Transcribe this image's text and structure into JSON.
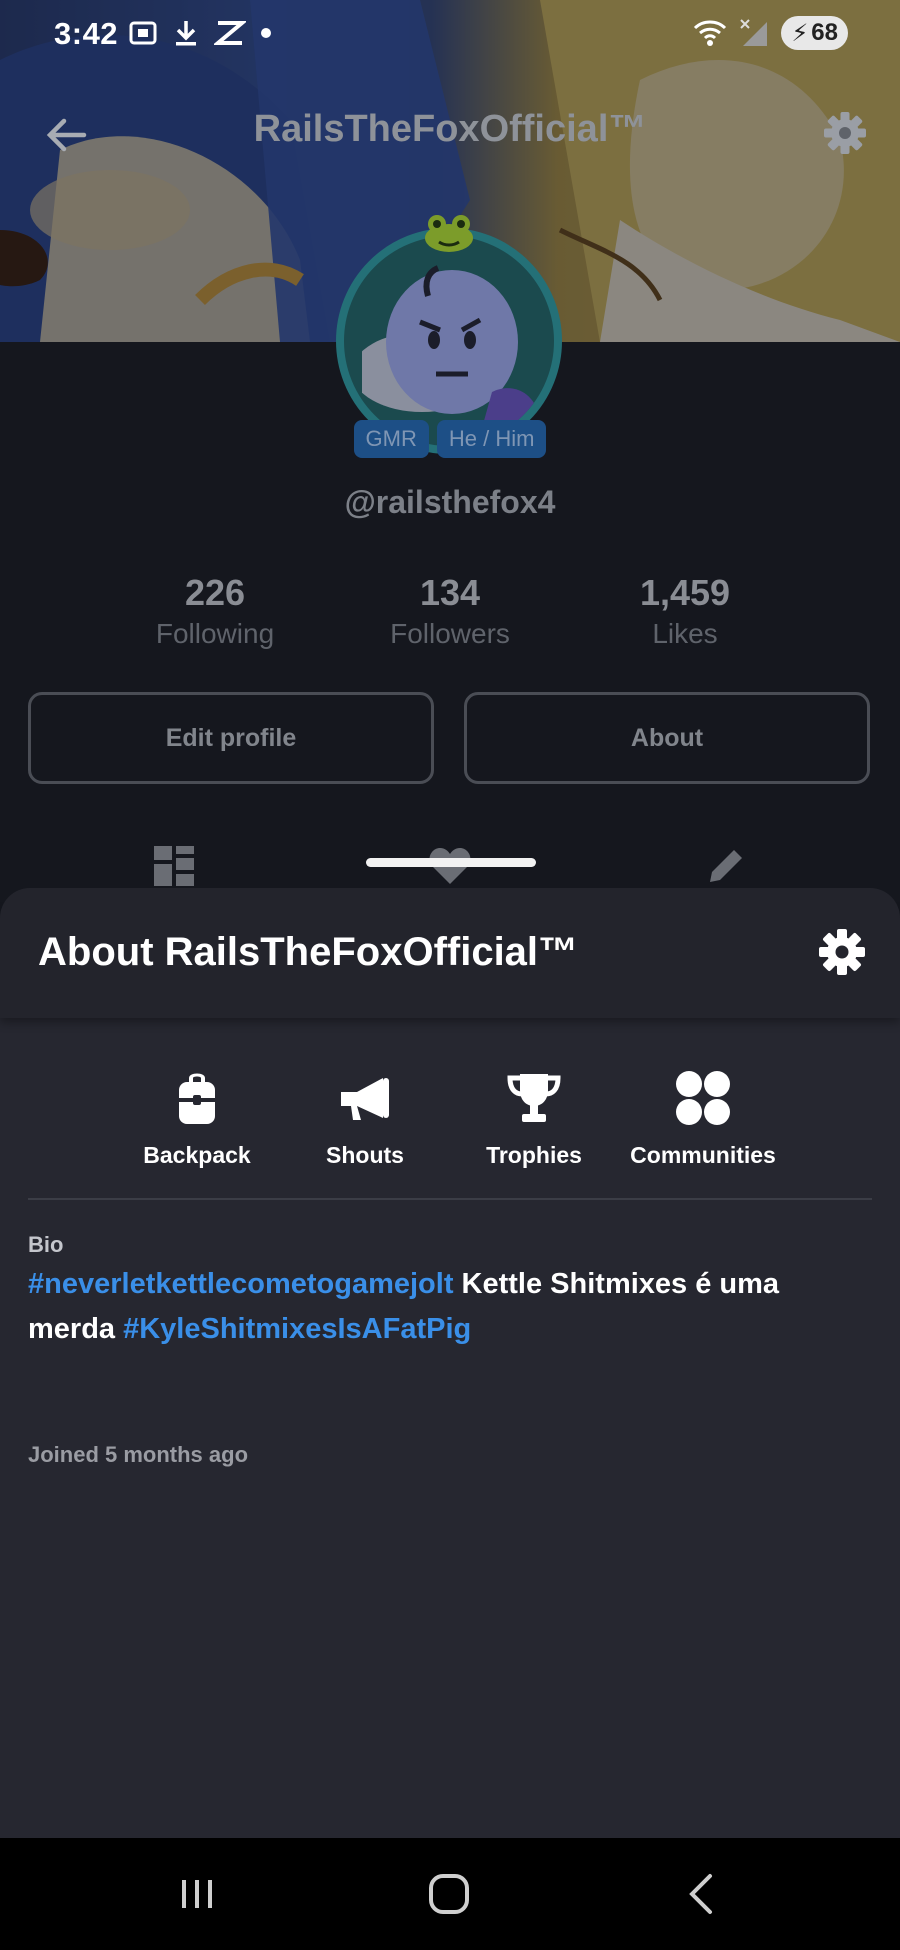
{
  "status_bar": {
    "time": "3:42",
    "battery": "68",
    "left_icons": [
      "screenshot-icon",
      "download-icon",
      "capcut-icon",
      "dot-icon"
    ],
    "right_icons": [
      "wifi-icon",
      "signal-icon",
      "battery-icon"
    ]
  },
  "profile": {
    "title": "RailsTheFoxOfficial™",
    "handle": "@railsthefox4",
    "tags": [
      "GMR",
      "He / Him"
    ],
    "stats": [
      {
        "value": "226",
        "label": "Following"
      },
      {
        "value": "134",
        "label": "Followers"
      },
      {
        "value": "1,459",
        "label": "Likes"
      }
    ],
    "buttons": {
      "edit": "Edit profile",
      "about": "About"
    },
    "tab_icons": [
      "grid-icon",
      "heart-icon",
      "pencil-icon"
    ]
  },
  "sheet": {
    "title": "About RailsTheFoxOfficial™",
    "quick_links": [
      {
        "label": "Backpack",
        "icon": "backpack-icon"
      },
      {
        "label": "Shouts",
        "icon": "megaphone-icon"
      },
      {
        "label": "Trophies",
        "icon": "trophy-icon"
      },
      {
        "label": "Communities",
        "icon": "communities-icon"
      }
    ],
    "bio_label": "Bio",
    "bio": {
      "hashtag1": "#neverletkettlecometogamejolt",
      "text_middle": " Kettle Shitmixes é uma merda ",
      "hashtag2": "#KyleShitmixesIsAFatPig"
    },
    "joined": "Joined 5 months ago"
  },
  "colors": {
    "sheet_bg": "#262730",
    "hashtag": "#3a8fe8",
    "page_bg": "#15171e",
    "tag_bg": "#1d4f86"
  },
  "nav_bar": {
    "buttons": [
      "recents-icon",
      "home-icon",
      "back-icon"
    ]
  }
}
